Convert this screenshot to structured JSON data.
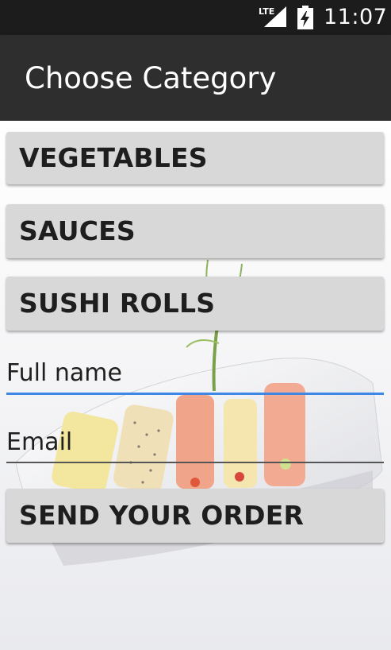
{
  "status_bar": {
    "network": "LTE",
    "time": "11:07"
  },
  "app_bar": {
    "title": "Choose Category"
  },
  "categories": [
    {
      "label": "VEGETABLES"
    },
    {
      "label": "SAUCES"
    },
    {
      "label": "SUSHI ROLLS"
    }
  ],
  "form": {
    "full_name_placeholder": "Full name",
    "full_name_value": "",
    "email_placeholder": "Email",
    "email_value": "",
    "send_label": "SEND YOUR ORDER"
  },
  "colors": {
    "status_bar": "#1c1c1c",
    "app_bar": "#2e2e2e",
    "button": "#d8d8d8",
    "focus_underline": "#3f87e4"
  },
  "icons": {
    "network": "lte-signal-icon",
    "battery": "battery-charging-icon",
    "background": "sushi-plate-image"
  }
}
